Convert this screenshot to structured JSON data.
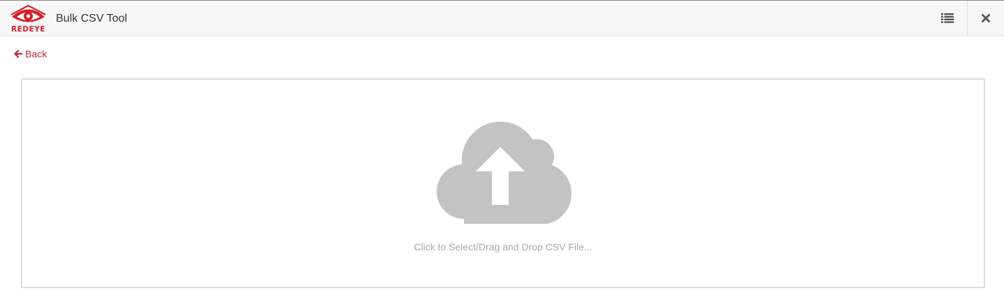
{
  "app": {
    "logo_text": "REDEYE",
    "title": "Bulk CSV Tool"
  },
  "header": {
    "list_icon": "list-icon",
    "close_icon": "close-icon"
  },
  "nav": {
    "back_label": "Back",
    "back_icon": "arrow-left-icon"
  },
  "upload": {
    "icon": "cloud-upload-icon",
    "prompt": "Click to Select/Drag and Drop CSV File..."
  },
  "colors": {
    "brand_red": "#c0272d",
    "icon_gray": "#c3c3c3",
    "text_gray": "#a8a8a8"
  }
}
